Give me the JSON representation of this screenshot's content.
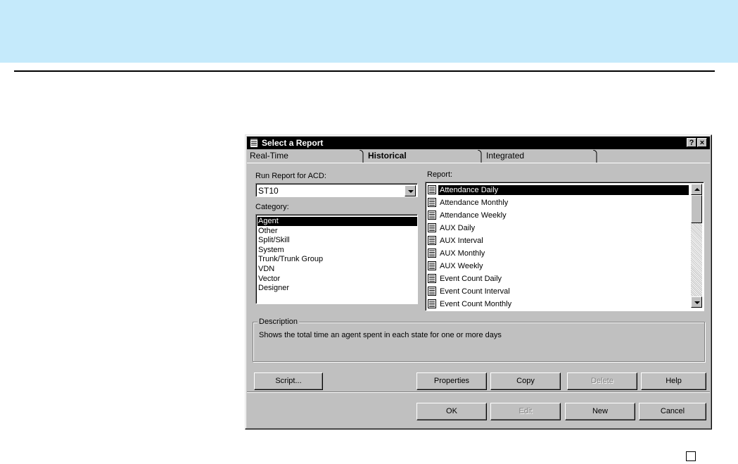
{
  "dialog": {
    "title": "Select a Report",
    "help_label": "?",
    "close_label": "×"
  },
  "tabs": [
    {
      "label": "Real-Time",
      "active": false
    },
    {
      "label": "Historical",
      "active": true
    },
    {
      "label": "Integrated",
      "active": false
    }
  ],
  "acd": {
    "label": "Run Report for ACD:",
    "value": "ST10"
  },
  "category": {
    "label": "Category:",
    "items": [
      "Agent",
      "Other",
      "Split/Skill",
      "System",
      "Trunk/Trunk Group",
      "VDN",
      "Vector",
      "Designer"
    ],
    "selected": "Agent"
  },
  "report": {
    "label": "Report:",
    "items": [
      "Attendance Daily",
      "Attendance Monthly",
      "Attendance Weekly",
      "AUX Daily",
      "AUX Interval",
      "AUX Monthly",
      "AUX Weekly",
      "Event Count Daily",
      "Event Count Interval",
      "Event Count Monthly"
    ],
    "selected": "Attendance Daily"
  },
  "description": {
    "legend": "Description",
    "text": "Shows the total time an agent spent in each state for one or more days"
  },
  "buttons": {
    "script": "Script...",
    "properties": "Properties",
    "copy": "Copy",
    "delete": "Delete",
    "help": "Help",
    "ok": "OK",
    "edit": "Edit",
    "new": "New",
    "cancel": "Cancel"
  },
  "colors": {
    "header_band": "#c5eafb",
    "dialog_face": "#c0c0c0",
    "selection": "#000000"
  }
}
